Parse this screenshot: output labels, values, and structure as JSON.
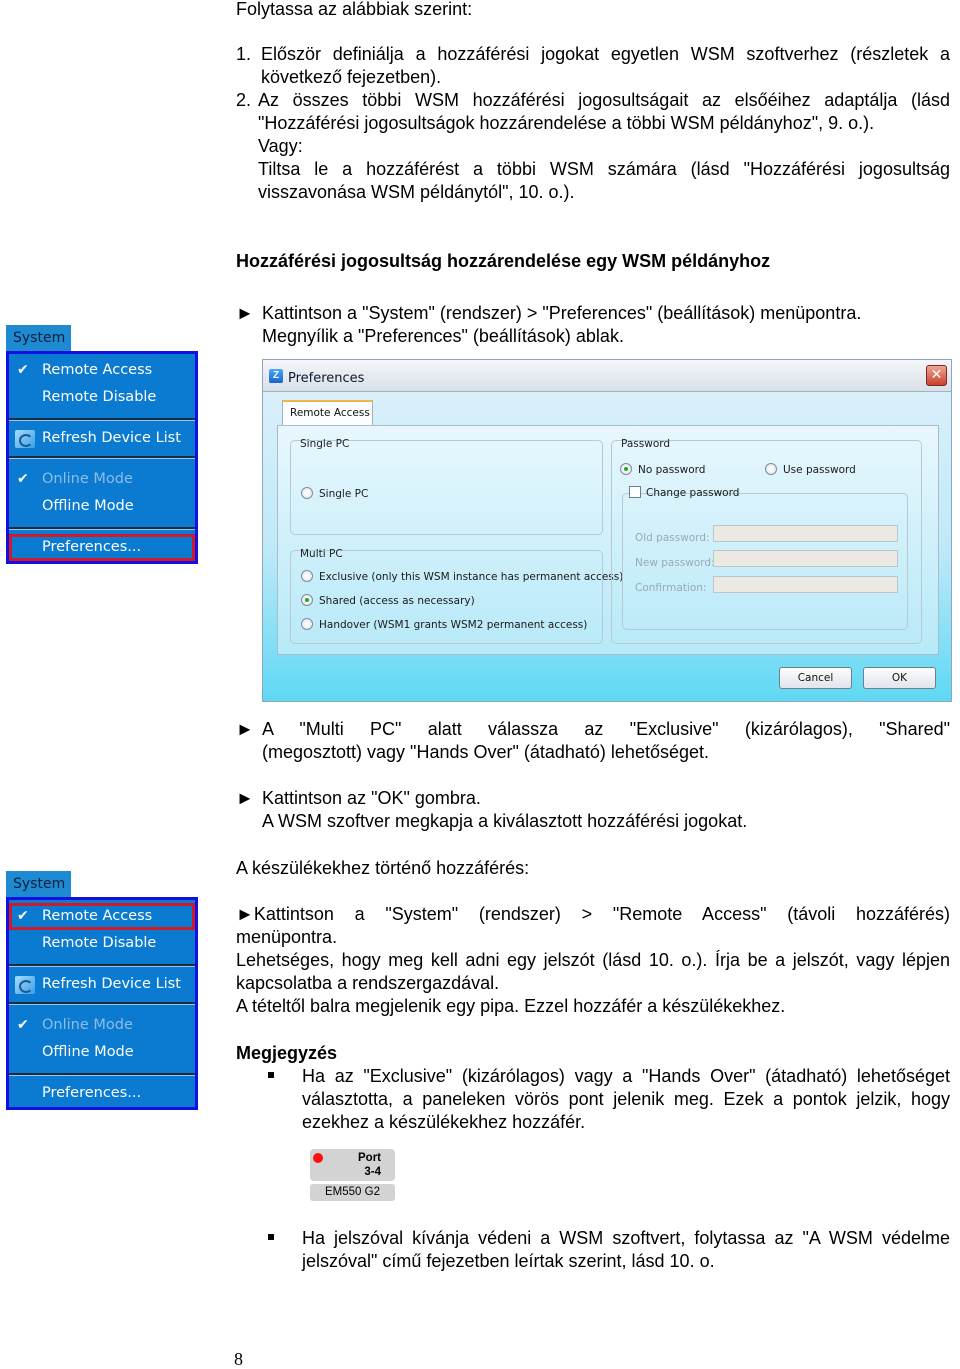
{
  "intro": "Folytassa az alábbiak szerint:",
  "steps": [
    {
      "num": "1.",
      "text": "Először definiálja a hozzáférési jogokat egyetlen WSM szoftverhez (részletek a következő fejezetben)."
    },
    {
      "num": "2.",
      "text": "Az összes többi WSM hozzáférési jogosultságait az elsőéihez adaptálja (lásd \"Hozzáférési jogosultságok hozzárendelése a többi WSM példányhoz\", 9. o.).",
      "or_label": "Vagy:",
      "alt": "Tiltsa le a hozzáférést a többi WSM számára (lásd \"Hozzáférési jogosultság visszavonása WSM példánytól\", 10. o.)."
    }
  ],
  "section_heading": "Hozzáférési jogosultság hozzárendelése egy WSM példányhoz",
  "instr1": {
    "arrow": "►",
    "text": "Kattintson a \"System\" (rendszer) > \"Preferences\" (beállítások) menüpontra.",
    "sub": "Megnyílik a \"Preferences\" (beállítások) ablak."
  },
  "menu": {
    "title": "System",
    "items": [
      {
        "label": "Remote Access",
        "checked": true,
        "icon": "check-icon"
      },
      {
        "label": "Remote Disable"
      },
      {
        "label": "Refresh Device List",
        "icon": "refresh-icon"
      },
      {
        "label": "Online Mode",
        "checked": true,
        "disabled": true,
        "icon": "check-icon"
      },
      {
        "label": "Offline Mode"
      },
      {
        "label": "Preferences..."
      }
    ],
    "check_glyph": "✔",
    "highlight_first": "Preferences...",
    "highlight_second": "Remote Access",
    "highlight_color": "#d01a2a",
    "bg_color": "#0a7bd0"
  },
  "dialog": {
    "title": "Preferences",
    "close_glyph": "✕",
    "tab": "Remote Access",
    "single_pc": {
      "legend": "Single PC",
      "option": "Single PC",
      "selected": false
    },
    "multi_pc": {
      "legend": "Multi PC",
      "options": [
        {
          "label": "Exclusive (only this WSM instance has permanent access)",
          "selected": false
        },
        {
          "label": "Shared (access as necessary)",
          "selected": true
        },
        {
          "label": "Handover (WSM1 grants WSM2 permanent access)",
          "selected": false
        }
      ]
    },
    "password": {
      "legend": "Password",
      "no_password": "No password",
      "use_password": "Use password",
      "selected": "No password",
      "change_password": "Change password",
      "change_checked": false,
      "old_label": "Old password:",
      "new_label": "New password:",
      "confirm_label": "Confirmation:",
      "old_value": "",
      "new_value": "",
      "confirm_value": ""
    },
    "cancel": "Cancel",
    "ok": "OK"
  },
  "instr2": {
    "arrow": "►",
    "text_a": "A \"Multi PC\" alatt válassza az \"Exclusive\" (kizárólagos), \"Shared\"",
    "text_b": "(megosztott) vagy \"Hands Over\" (átadható) lehetőséget."
  },
  "instr3": {
    "arrow": "►",
    "text": "Kattintson az \"OK\" gombra.",
    "sub": "A WSM szoftver megkapja a kiválasztott hozzáférési jogokat."
  },
  "device_access_heading": "A készülékekhez történő hozzáférés:",
  "instr4": {
    "arrow": "►",
    "text_a": "Kattintson a \"System\" (rendszer) > \"Remote Access\" (távoli hozzáférés)",
    "text_b": "menüpontra.",
    "p2": "Lehetséges, hogy meg kell adni egy jelszót (lásd 10. o.). Írja be a jelszót, vagy lépjen kapcsolatba a rendszergazdával.",
    "p3": "A tételtől balra megjelenik egy pipa. Ezzel hozzáfér a készülékekhez."
  },
  "note": {
    "heading": "Megjegyzés",
    "items": [
      "Ha az \"Exclusive\" (kizárólagos) vagy a \"Hands Over\" (átadható) lehetőséget választotta, a paneleken vörös pont jelenik meg. Ezek a pontok jelzik, hogy ezekhez a készülékekhez hozzáfér.",
      "Ha jelszóval kívánja védeni a WSM szoftvert, folytassa az \"A WSM védelme jelszóval\" című fejezetben leírtak szerint, lásd 10. o."
    ]
  },
  "port_widget": {
    "line1": "Port",
    "line2": "3-4",
    "model": "EM550 G2",
    "dot_color": "#ff1010"
  },
  "page_number": "8"
}
